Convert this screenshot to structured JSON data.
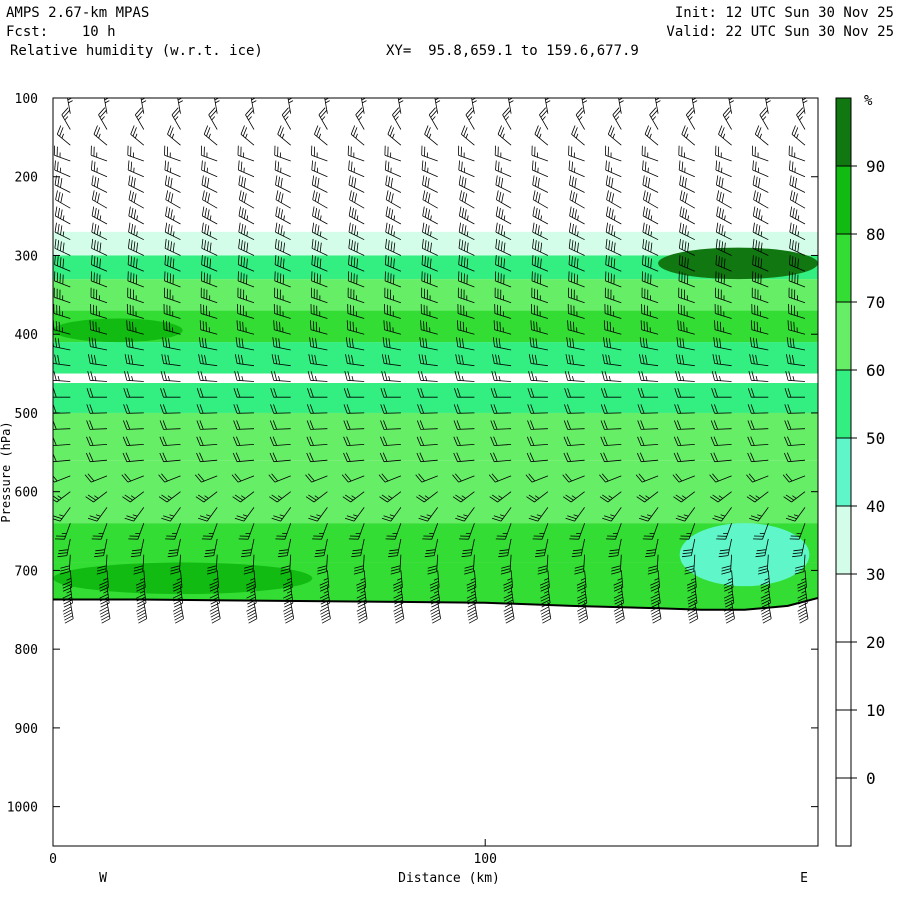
{
  "header": {
    "model": "AMPS 2.67-km MPAS",
    "fcst": "Fcst:    10 h",
    "field": "Relative humidity (w.r.t. ice)",
    "xy": "XY=  95.8,659.1 to 159.6,677.9",
    "init": "Init: 12 UTC Sun 30 Nov 25",
    "valid": "Valid: 22 UTC Sun 30 Nov 25"
  },
  "colors": {
    "bands": [
      "#ffffff",
      "#ffffff",
      "#ffffff",
      "#ffffff",
      "#d4fde9",
      "#5ff7c9",
      "#33ee80",
      "#66ee66",
      "#33dd33",
      "#11bb11",
      "#117711"
    ],
    "ground": "#ffffff",
    "terrain_line": "#000000",
    "barb": "#000000"
  },
  "chart_data": {
    "type": "heatmap",
    "title": "Relative humidity (w.r.t. ice)",
    "xlabel": "Distance (km)",
    "ylabel": "Pressure (hPa)",
    "x_ticks": [
      0,
      100
    ],
    "xlim": [
      0,
      177
    ],
    "y_ticks": [
      100,
      200,
      300,
      400,
      500,
      600,
      700,
      800,
      900,
      1000
    ],
    "ylim": [
      100,
      1050
    ],
    "y_scale": "linear-inverted",
    "x_end_labels": {
      "left": "W",
      "right": "E"
    },
    "colorbar": {
      "unit": "%",
      "levels": [
        0,
        10,
        20,
        30,
        40,
        50,
        60,
        70,
        80,
        90
      ]
    },
    "rh_layers": [
      {
        "p_top": 270,
        "p_bottom": 300,
        "rh": 35
      },
      {
        "p_top": 300,
        "p_bottom": 330,
        "rh": 50
      },
      {
        "p_top": 330,
        "p_bottom": 370,
        "rh": 65
      },
      {
        "p_top": 370,
        "p_bottom": 410,
        "rh": 75
      },
      {
        "p_top": 410,
        "p_bottom": 450,
        "rh": 55
      },
      {
        "p_top": 450,
        "p_bottom": 462,
        "rh": 28
      },
      {
        "p_top": 462,
        "p_bottom": 500,
        "rh": 55
      },
      {
        "p_top": 500,
        "p_bottom": 560,
        "rh": 60
      },
      {
        "p_top": 560,
        "p_bottom": 640,
        "rh": 65
      },
      {
        "p_top": 640,
        "p_bottom": 690,
        "rh": 70
      },
      {
        "p_top": 690,
        "p_bottom": 760,
        "rh": 75
      }
    ],
    "rh_features": [
      {
        "x0": 0,
        "x1": 30,
        "p_top": 380,
        "p_bottom": 410,
        "rh": 85
      },
      {
        "x0": 140,
        "x1": 177,
        "p_top": 290,
        "p_bottom": 330,
        "rh": 92
      },
      {
        "x0": 0,
        "x1": 60,
        "p_top": 690,
        "p_bottom": 730,
        "rh": 88
      },
      {
        "x0": 145,
        "x1": 175,
        "p_top": 640,
        "p_bottom": 720,
        "rh": 48
      }
    ],
    "terrain": {
      "x": [
        0,
        20,
        40,
        60,
        80,
        100,
        120,
        140,
        150,
        160,
        170,
        177
      ],
      "p": [
        737,
        737,
        738,
        739,
        740,
        741,
        745,
        748,
        750,
        750,
        745,
        735
      ]
    },
    "barb_columns_x": [
      4,
      12.5,
      21,
      29.5,
      38,
      46.5,
      55,
      63.5,
      72,
      80.5,
      89,
      97.5,
      106,
      114.5,
      123,
      131.5,
      140,
      148.5,
      157,
      165.5,
      174
    ],
    "barb_levels_p": [
      120,
      140,
      160,
      180,
      200,
      220,
      240,
      260,
      280,
      300,
      320,
      340,
      360,
      380,
      400,
      420,
      440,
      460,
      480,
      500,
      520,
      540,
      560,
      580,
      600,
      620,
      640,
      660,
      680,
      700,
      720,
      740
    ],
    "barb_profile": [
      {
        "p": 120,
        "dir": 350,
        "spd": 25
      },
      {
        "p": 180,
        "dir": 290,
        "spd": 25
      },
      {
        "p": 240,
        "dir": 300,
        "spd": 30
      },
      {
        "p": 300,
        "dir": 295,
        "spd": 40
      },
      {
        "p": 400,
        "dir": 285,
        "spd": 35
      },
      {
        "p": 480,
        "dir": 270,
        "spd": 20
      },
      {
        "p": 560,
        "dir": 265,
        "spd": 20
      },
      {
        "p": 640,
        "dir": 200,
        "spd": 25
      },
      {
        "p": 700,
        "dir": 175,
        "spd": 35
      },
      {
        "p": 740,
        "dir": 170,
        "spd": 50
      }
    ]
  }
}
